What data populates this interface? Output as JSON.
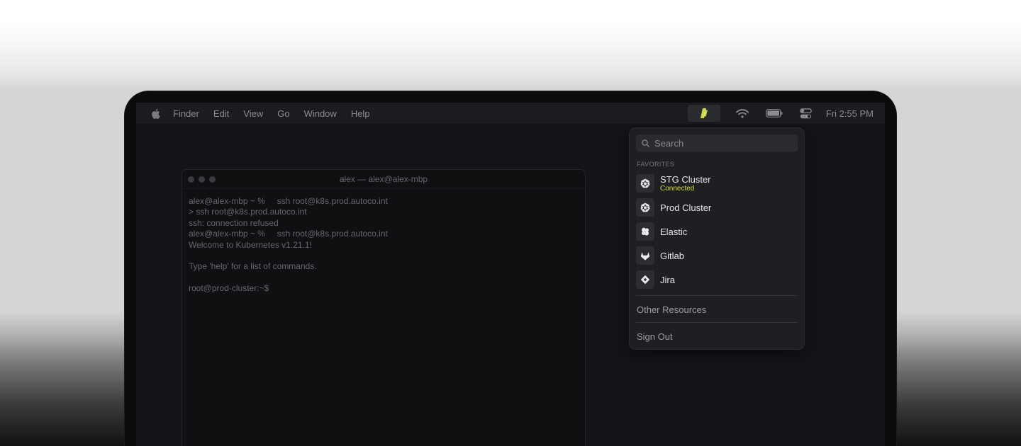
{
  "menubar": {
    "items": [
      "Finder",
      "Edit",
      "View",
      "Go",
      "Window",
      "Help"
    ],
    "clock": "Fri 2:55 PM"
  },
  "terminal": {
    "title": "alex — alex@alex-mbp",
    "lines": [
      "alex@alex-mbp ~ %     ssh root@k8s.prod.autoco.int",
      "> ssh root@k8s.prod.autoco.int",
      "ssh: connection refused",
      "alex@alex-mbp ~ %     ssh root@k8s.prod.autoco.int",
      "Welcome to Kubernetes v1.21.1!",
      "",
      "Type 'help' for a list of commands.",
      "",
      "root@prod-cluster:~$"
    ]
  },
  "dropdown": {
    "search_placeholder": "Search",
    "section_label": "FAVORITES",
    "favorites": [
      {
        "name": "STG Cluster",
        "status": "Connected",
        "icon": "kubernetes-icon"
      },
      {
        "name": "Prod Cluster",
        "status": "",
        "icon": "kubernetes-icon"
      },
      {
        "name": "Elastic",
        "status": "",
        "icon": "elastic-icon"
      },
      {
        "name": "Gitlab",
        "status": "",
        "icon": "gitlab-icon"
      },
      {
        "name": "Jira",
        "status": "",
        "icon": "jira-icon"
      }
    ],
    "other_resources": "Other Resources",
    "sign_out": "Sign Out"
  },
  "colors": {
    "accent": "#d3dc3c",
    "menubar_bg": "#1b1c1f",
    "dropdown_bg": "#1e1f22"
  }
}
